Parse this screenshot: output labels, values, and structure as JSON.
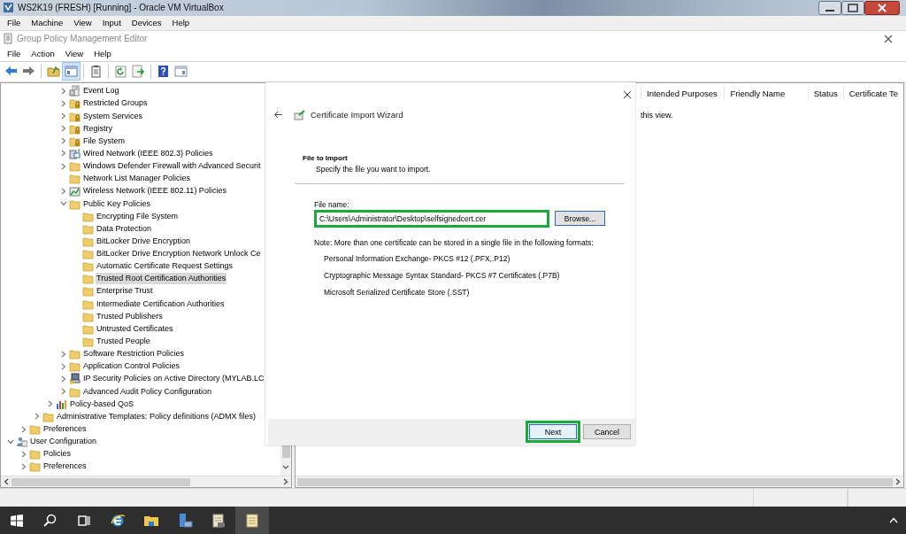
{
  "vm_window": {
    "title": "WS2K19 (FRESH) [Running] - Oracle VM VirtualBox",
    "menu": [
      "File",
      "Machine",
      "View",
      "Input",
      "Devices",
      "Help"
    ]
  },
  "app_window": {
    "title": "Group Policy Management Editor",
    "menu": [
      "File",
      "Action",
      "View",
      "Help"
    ],
    "toolbar": [
      {
        "kind": "back",
        "pressed": false
      },
      {
        "kind": "forward",
        "pressed": false
      },
      {
        "kind": "sep"
      },
      {
        "kind": "up",
        "pressed": false
      },
      {
        "kind": "tree",
        "pressed": true
      },
      {
        "kind": "sep"
      },
      {
        "kind": "properties",
        "pressed": false
      },
      {
        "kind": "sep"
      },
      {
        "kind": "refresh",
        "pressed": false
      },
      {
        "kind": "export",
        "pressed": false
      },
      {
        "kind": "sep"
      },
      {
        "kind": "help",
        "pressed": false
      },
      {
        "kind": "pane",
        "pressed": false
      }
    ]
  },
  "tree": [
    {
      "children": [
        {
          "children": [
            {
              "children": [
                {
                  "children": [
                    {
                      "label": "Event Log",
                      "kind": "log",
                      "expanded": false,
                      "selected": false
                    },
                    {
                      "label": "Restricted Groups",
                      "kind": "locked",
                      "expanded": false,
                      "selected": false
                    },
                    {
                      "label": "System Services",
                      "kind": "locked",
                      "expanded": false,
                      "selected": false
                    },
                    {
                      "label": "Registry",
                      "kind": "locked",
                      "expanded": false,
                      "selected": false
                    },
                    {
                      "label": "File System",
                      "kind": "locked",
                      "expanded": false,
                      "selected": false
                    },
                    {
                      "label": "Wired Network (IEEE 802.3) Policies",
                      "kind": "network",
                      "expanded": false,
                      "selected": false
                    },
                    {
                      "label": "Windows Defender Firewall with Advanced Securit",
                      "kind": "folder",
                      "expanded": false,
                      "selected": false
                    },
                    {
                      "label": "Network List Manager Policies",
                      "kind": "folder",
                      "selected": false
                    },
                    {
                      "label": "Wireless Network (IEEE 802.11) Policies",
                      "kind": "wireless",
                      "expanded": false,
                      "selected": false
                    },
                    {
                      "label": "Public Key Policies",
                      "kind": "folder",
                      "expanded": true,
                      "selected": false,
                      "children": [
                        {
                          "label": "Encrypting File System",
                          "kind": "folder",
                          "selected": false
                        },
                        {
                          "label": "Data Protection",
                          "kind": "folder",
                          "selected": false
                        },
                        {
                          "label": "BitLocker Drive Encryption",
                          "kind": "folder",
                          "selected": false
                        },
                        {
                          "label": "BitLocker Drive Encryption Network Unlock Ce",
                          "kind": "folder",
                          "selected": false
                        },
                        {
                          "label": "Automatic Certificate Request Settings",
                          "kind": "folder",
                          "selected": false
                        },
                        {
                          "label": "Trusted Root Certification Authorities",
                          "kind": "folder",
                          "selected": true
                        },
                        {
                          "label": "Enterprise Trust",
                          "kind": "folder",
                          "selected": false
                        },
                        {
                          "label": "Intermediate Certification Authorities",
                          "kind": "folder",
                          "selected": false
                        },
                        {
                          "label": "Trusted Publishers",
                          "kind": "folder",
                          "selected": false
                        },
                        {
                          "label": "Untrusted Certificates",
                          "kind": "folder",
                          "selected": false
                        },
                        {
                          "label": "Trusted People",
                          "kind": "folder",
                          "selected": false
                        }
                      ]
                    },
                    {
                      "label": "Software Restriction Policies",
                      "kind": "folder",
                      "expanded": false,
                      "selected": false
                    },
                    {
                      "label": "Application Control Policies",
                      "kind": "folder",
                      "expanded": false,
                      "selected": false
                    },
                    {
                      "label": "IP Security Policies on Active Directory (MYLAB.LC",
                      "kind": "ipsec",
                      "expanded": false,
                      "selected": false
                    },
                    {
                      "label": "Advanced Audit Policy Configuration",
                      "kind": "folder",
                      "expanded": false,
                      "selected": false
                    }
                  ]
                },
                {
                  "label": "Policy-based QoS",
                  "kind": "qos",
                  "expanded": false,
                  "selected": false
                }
              ]
            },
            {
              "label": "Administrative Templates: Policy definitions (ADMX files)",
              "kind": "folder",
              "expanded": false,
              "selected": false
            }
          ]
        },
        {
          "label": "Preferences",
          "kind": "folder",
          "expanded": false,
          "selected": false
        }
      ]
    },
    {
      "label": "User Configuration",
      "kind": "users",
      "expanded": true,
      "selected": false,
      "children": [
        {
          "label": "Policies",
          "kind": "folder",
          "expanded": false,
          "selected": false
        },
        {
          "label": "Preferences",
          "kind": "folder",
          "expanded": false,
          "selected": false
        }
      ]
    }
  ],
  "list_view": {
    "columns": [
      "Intended Purposes",
      "Friendly Name",
      "Status",
      "Certificate Te"
    ],
    "message": "this view."
  },
  "wizard": {
    "title": "Certificate Import Wizard",
    "heading": "File to Import",
    "subheading": "Specify the file you want to import.",
    "field_label": "File name:",
    "file_name": "C:\\Users\\Administrator\\Desktop\\selfsignedcert.cer",
    "field_highlighted": true,
    "browse": "Browse...",
    "note": "Note:  More than one certificate can be stored in a single file in the following formats:",
    "formats": [
      "Personal Information Exchange- PKCS #12 (.PFX,.P12)",
      "Cryptographic Message Syntax Standard- PKCS #7 Certificates (.P7B)",
      "Microsoft Serialized Certificate Store (.SST)"
    ],
    "buttons": [
      {
        "label": "Next",
        "highlighted": true
      },
      {
        "label": "Cancel",
        "highlighted": false
      }
    ]
  },
  "taskbar": [
    {
      "kind": "start",
      "active": false
    },
    {
      "kind": "search",
      "active": false
    },
    {
      "kind": "taskview",
      "active": false
    },
    {
      "kind": "browser",
      "active": false
    },
    {
      "kind": "explorer",
      "active": false
    },
    {
      "kind": "server",
      "active": false
    },
    {
      "kind": "gpm",
      "active": false
    },
    {
      "kind": "editor",
      "active": true
    }
  ]
}
